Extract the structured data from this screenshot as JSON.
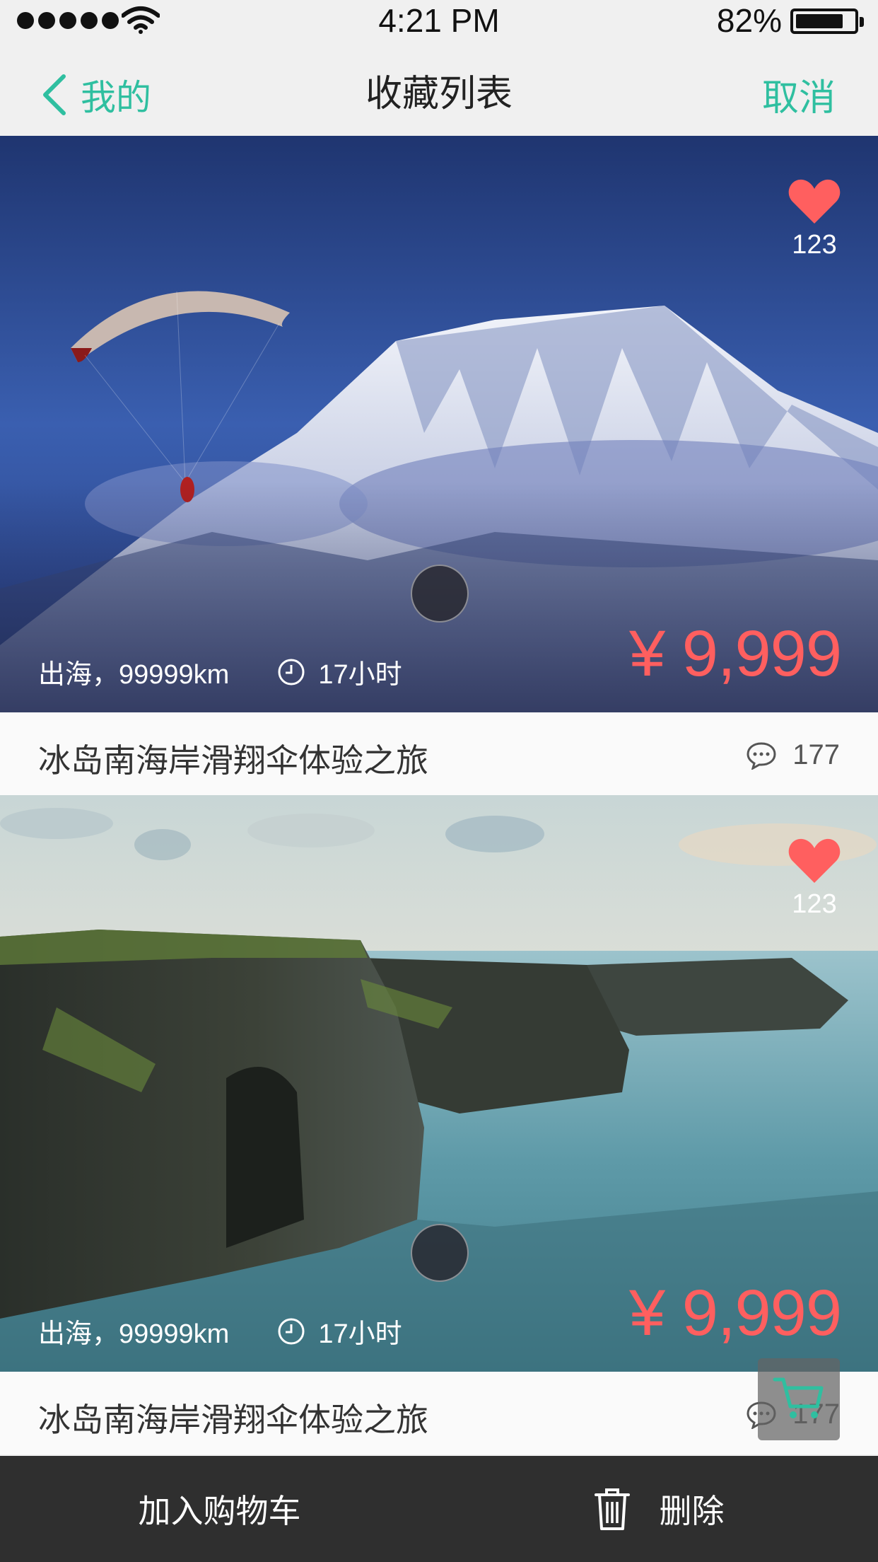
{
  "status_bar": {
    "time": "4:21 PM",
    "battery": "82%",
    "signal_icon": "signal-dots-icon",
    "wifi_icon": "wifi-icon",
    "battery_icon": "battery-icon"
  },
  "nav": {
    "back_label": "我的",
    "title": "收藏列表",
    "cancel_label": "取消",
    "back_icon": "chevron-left-icon"
  },
  "colors": {
    "accent": "#2fbfa0",
    "price": "#ff5f5f",
    "bottom_bar": "#2f2f2f"
  },
  "items": [
    {
      "fav_count": "123",
      "meta_text": "出海，99999km",
      "duration": "17小时",
      "price": "¥ 9,999",
      "title": "冰岛南海岸滑翔伞体验之旅",
      "comment_count": "177"
    },
    {
      "fav_count": "123",
      "meta_text": "出海，99999km",
      "duration": "17小时",
      "price": "¥ 9,999",
      "title": "冰岛南海岸滑翔伞体验之旅",
      "comment_count": "177"
    }
  ],
  "bottom_bar": {
    "add_to_cart_label": "加入购物车",
    "delete_label": "删除",
    "delete_icon": "trash-icon"
  },
  "cart_fab": {
    "icon": "shopping-cart-icon"
  }
}
